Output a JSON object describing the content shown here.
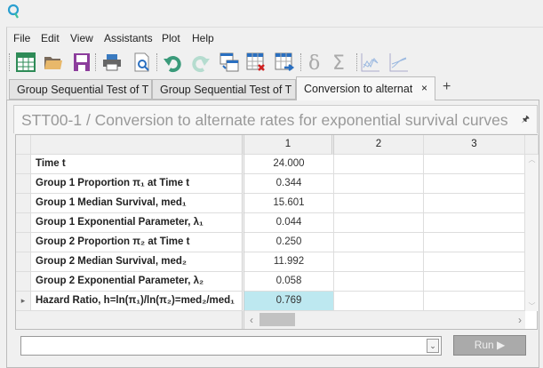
{
  "app": {
    "logo": "Q"
  },
  "menu": [
    "File",
    "Edit",
    "View",
    "Assistants",
    "Plot",
    "Help"
  ],
  "toolbar": [
    "new-table-icon",
    "open-folder-icon",
    "save-icon",
    "print-icon",
    "print-preview-icon",
    "undo-icon",
    "redo-icon",
    "insert-table-icon",
    "delete-table-icon",
    "append-table-icon",
    "delta-icon",
    "sigma-icon",
    "line-chart-icon",
    "area-chart-icon"
  ],
  "tabs": [
    {
      "label": "Group Sequential Test of T"
    },
    {
      "label": "Group Sequential Test of T"
    },
    {
      "label": "Conversion to alternate rates",
      "close": "×"
    }
  ],
  "new_tab": "+",
  "panel": {
    "title": "STT00-1 / Conversion to alternate rates for exponential survival curves",
    "pin": "🖈"
  },
  "grid": {
    "columns": [
      "1",
      "2",
      "3"
    ],
    "rows": [
      {
        "label": "Time t",
        "values": [
          "24.000",
          "",
          ""
        ]
      },
      {
        "label": "Group 1 Proportion π₁ at Time t",
        "values": [
          "0.344",
          "",
          ""
        ]
      },
      {
        "label": "Group 1 Median Survival, med₁",
        "values": [
          "15.601",
          "",
          ""
        ]
      },
      {
        "label": "Group 1 Exponential Parameter, λ₁",
        "values": [
          "0.044",
          "",
          ""
        ]
      },
      {
        "label": "Group 2 Proportion π₂ at Time t",
        "values": [
          "0.250",
          "",
          ""
        ]
      },
      {
        "label": "Group 2 Median Survival, med₂",
        "values": [
          "11.992",
          "",
          ""
        ]
      },
      {
        "label": "Group 2 Exponential Parameter, λ₂",
        "values": [
          "0.058",
          "",
          ""
        ]
      },
      {
        "label": "Hazard Ratio, h=ln(π₁)/ln(π₂)=med₂/med₁",
        "values": [
          "0.769",
          "",
          ""
        ],
        "current": true
      }
    ],
    "selected_color": "#bde8f0"
  },
  "bottom": {
    "combo_value": "",
    "run_label": "Run ▶"
  }
}
